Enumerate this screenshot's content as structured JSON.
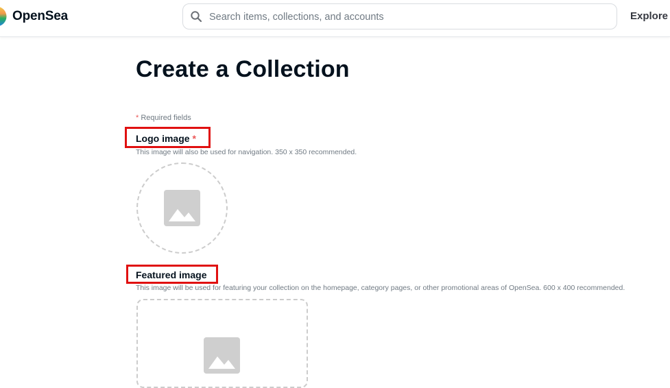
{
  "header": {
    "brand": "OpenSea",
    "search_placeholder": "Search items, collections, and accounts",
    "search_value": "",
    "nav": {
      "explore": "Explore"
    }
  },
  "main": {
    "title": "Create a Collection",
    "required_note": {
      "asterisk": "*",
      "text": " Required fields"
    },
    "logo_field": {
      "label": "Logo image",
      "asterisk": "*",
      "help": "This image will also be used for navigation. 350 x 350 recommended.",
      "icon": "image-placeholder-icon"
    },
    "featured_field": {
      "label": "Featured image",
      "help": "This image will be used for featuring your collection on the homepage, category pages, or other promotional areas of OpenSea. 600 x 400 recommended.",
      "icon": "image-placeholder-icon"
    }
  },
  "colors": {
    "text": "#04111d",
    "muted": "#707a83",
    "required": "#eb5757",
    "highlight_box": "#e01010",
    "dashed_border": "#cccccc",
    "placeholder_icon": "#cfcfcf"
  }
}
